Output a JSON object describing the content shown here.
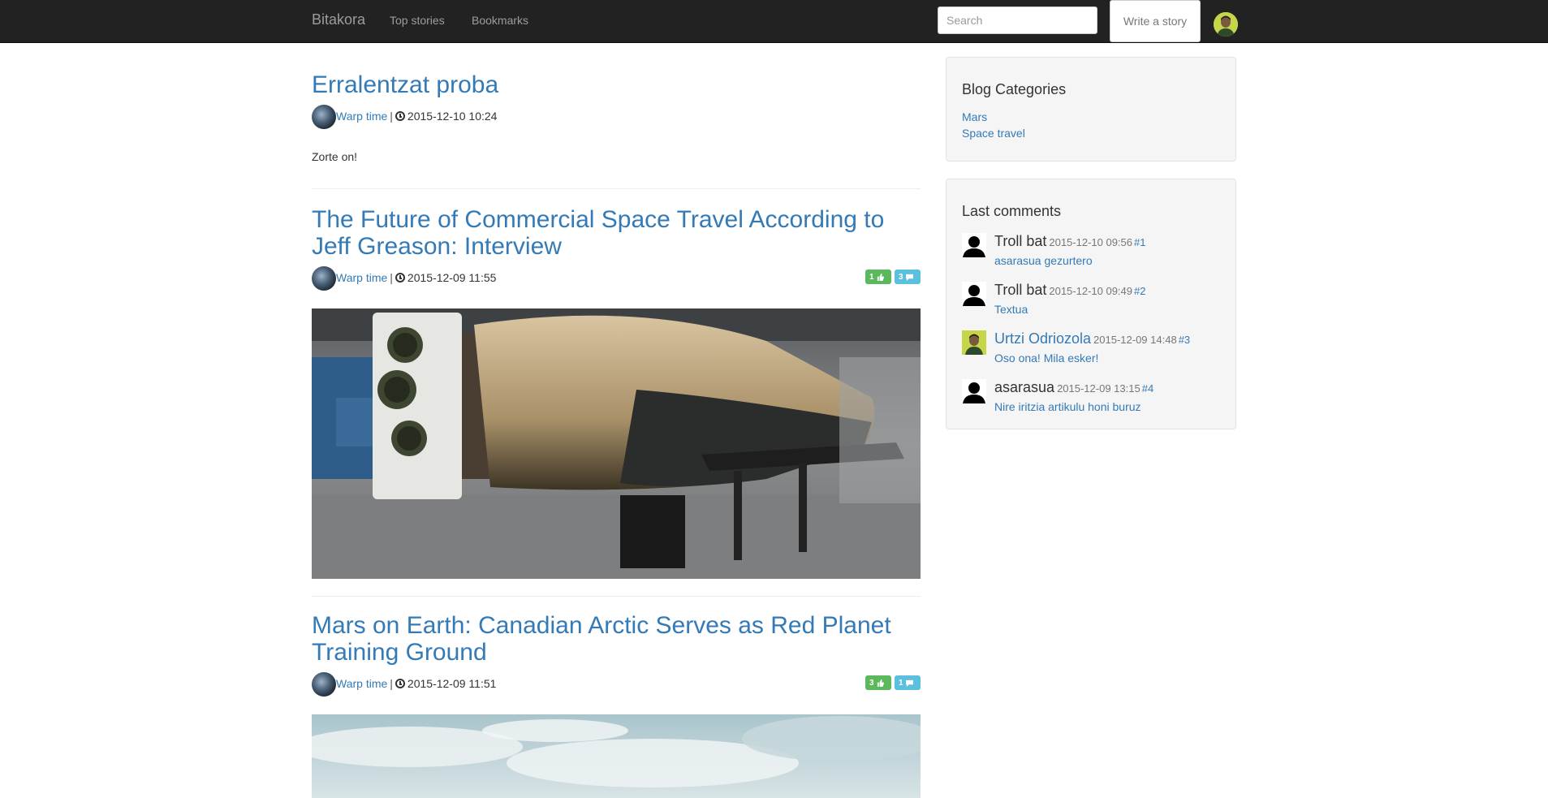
{
  "navbar": {
    "brand": "Bitakora",
    "links": [
      "Top stories",
      "Bookmarks"
    ],
    "search_placeholder": "Search",
    "write_label": "Write a story"
  },
  "posts": [
    {
      "title": "Erralentzat proba",
      "author": "Warp time",
      "date": "2015-12-10 10:24",
      "excerpt": "Zorte on!"
    },
    {
      "title": "The Future of Commercial Space Travel According to Jeff Greason: Interview",
      "author": "Warp time",
      "date": "2015-12-09 11:55",
      "likes": "1",
      "comments": "3"
    },
    {
      "title": "Mars on Earth: Canadian Arctic Serves as Red Planet Training Ground",
      "author": "Warp time",
      "date": "2015-12-09 11:51",
      "likes": "3",
      "comments": "1"
    }
  ],
  "sidebar": {
    "categories_title": "Blog Categories",
    "categories": [
      "Mars",
      "Space travel"
    ],
    "comments_title": "Last comments",
    "comments": [
      {
        "author": "Troll bat",
        "date": "2015-12-10 09:56",
        "num": "#1",
        "text": "asarasua gezurtero"
      },
      {
        "author": "Troll bat",
        "date": "2015-12-10 09:49",
        "num": "#2",
        "text": "Textua"
      },
      {
        "author": "Urtzi Odriozola",
        "date": "2015-12-09 14:48",
        "num": "#3",
        "text": "Oso ona! Mila esker!"
      },
      {
        "author": "asarasua",
        "date": "2015-12-09 13:15",
        "num": "#4",
        "text": "Nire iritzia artikulu honi buruz"
      }
    ]
  },
  "colors": {
    "navbar": "#222222",
    "link": "#337ab7",
    "like_badge": "#5cb85c",
    "comment_badge": "#5bc0de"
  }
}
